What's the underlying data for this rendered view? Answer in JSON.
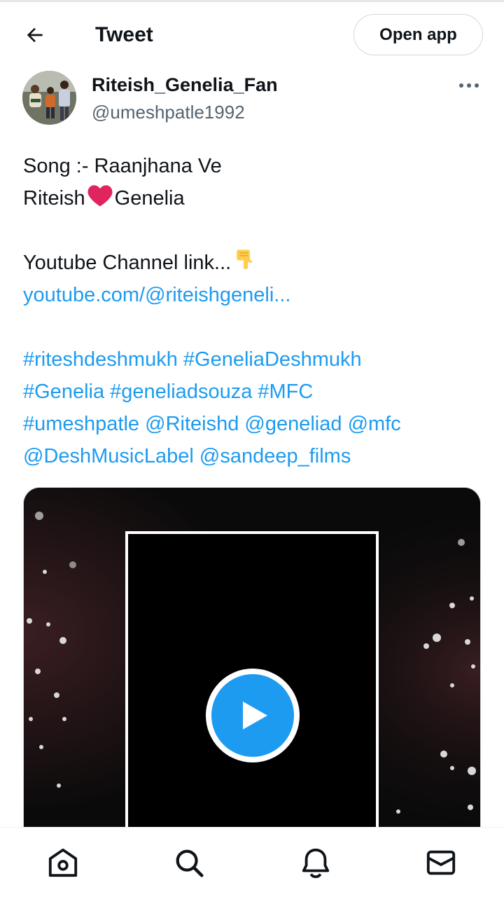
{
  "header": {
    "title": "Tweet",
    "open_app_label": "Open app"
  },
  "author": {
    "name": "Riteish_Genelia_Fan",
    "handle": "@umeshpatle1992"
  },
  "tweet": {
    "line1": "Song :- Raanjhana Ve",
    "line2_a": "Riteish",
    "line2_emoji": "❤",
    "line2_b": "Genelia",
    "line3": "Youtube Channel link...",
    "line3_emoji": "👇",
    "link": "youtube.com/@riteishgeneli...",
    "hashtags": [
      [
        "#riteshdeshmukh",
        "#GeneliaDeshmukh"
      ],
      [
        "#Genelia",
        "#geneliadsouza",
        "#MFC"
      ],
      [
        "#umeshpatle",
        "@Riteishd",
        "@geneliad",
        "@mfc"
      ],
      [
        "@DeshMusicLabel",
        "@sandeep_films"
      ]
    ]
  },
  "colors": {
    "accent": "#1d9bf0",
    "text_primary": "#0f1419",
    "text_secondary": "#536471",
    "heart": "#e0245e"
  },
  "icons": {
    "back": "arrow-left-icon",
    "more": "more-horizontal-icon",
    "play": "play-icon",
    "nav": [
      "home-icon",
      "search-icon",
      "notifications-bell-icon",
      "messages-envelope-icon"
    ]
  }
}
